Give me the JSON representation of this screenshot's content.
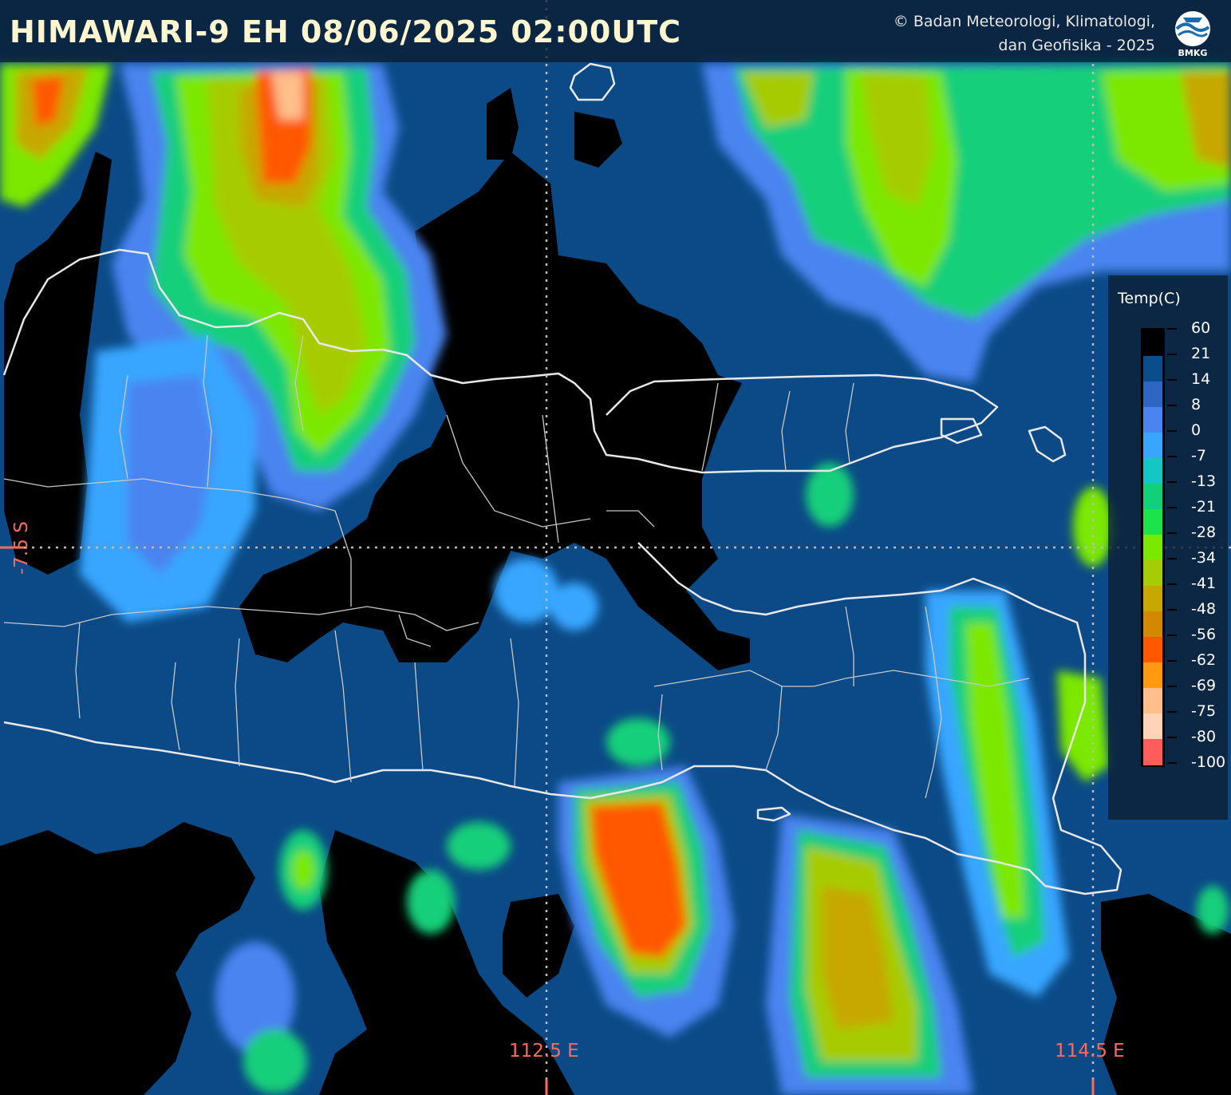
{
  "header": {
    "title": "HIMAWARI-9 EH  08/06/2025  02:00UTC",
    "credit_line1": "© Badan Meteorologi, Klimatologi,",
    "credit_line2": "dan Geofisika -  2025",
    "logo_text": "BMKG"
  },
  "coordinates": {
    "lat_label": "-7.5 S",
    "lon_label_1": "112.5 E",
    "lon_label_2": "114.5 E"
  },
  "legend": {
    "title": "Temp(C)",
    "labels": [
      "60",
      "21",
      "14",
      "8",
      "0",
      "-7",
      "-13",
      "-21",
      "-28",
      "-34",
      "-41",
      "-48",
      "-56",
      "-62",
      "-69",
      "-75",
      "-80",
      "-100"
    ],
    "colors": [
      "#000000",
      "#0a4d8c",
      "#2f66c4",
      "#4a84f0",
      "#38a6ff",
      "#14c7c4",
      "#12cf7a",
      "#1ce34a",
      "#7be800",
      "#a6cc06",
      "#c6a800",
      "#d28800",
      "#ff5800",
      "#ff9a10",
      "#ffbe8a",
      "#ffd3b8",
      "#ff5d5d",
      "#ff0000"
    ]
  },
  "colors": {
    "accent_coord": "#ff6a5a",
    "title_color": "#fff6cf",
    "boundary": "#e8e8e8"
  }
}
